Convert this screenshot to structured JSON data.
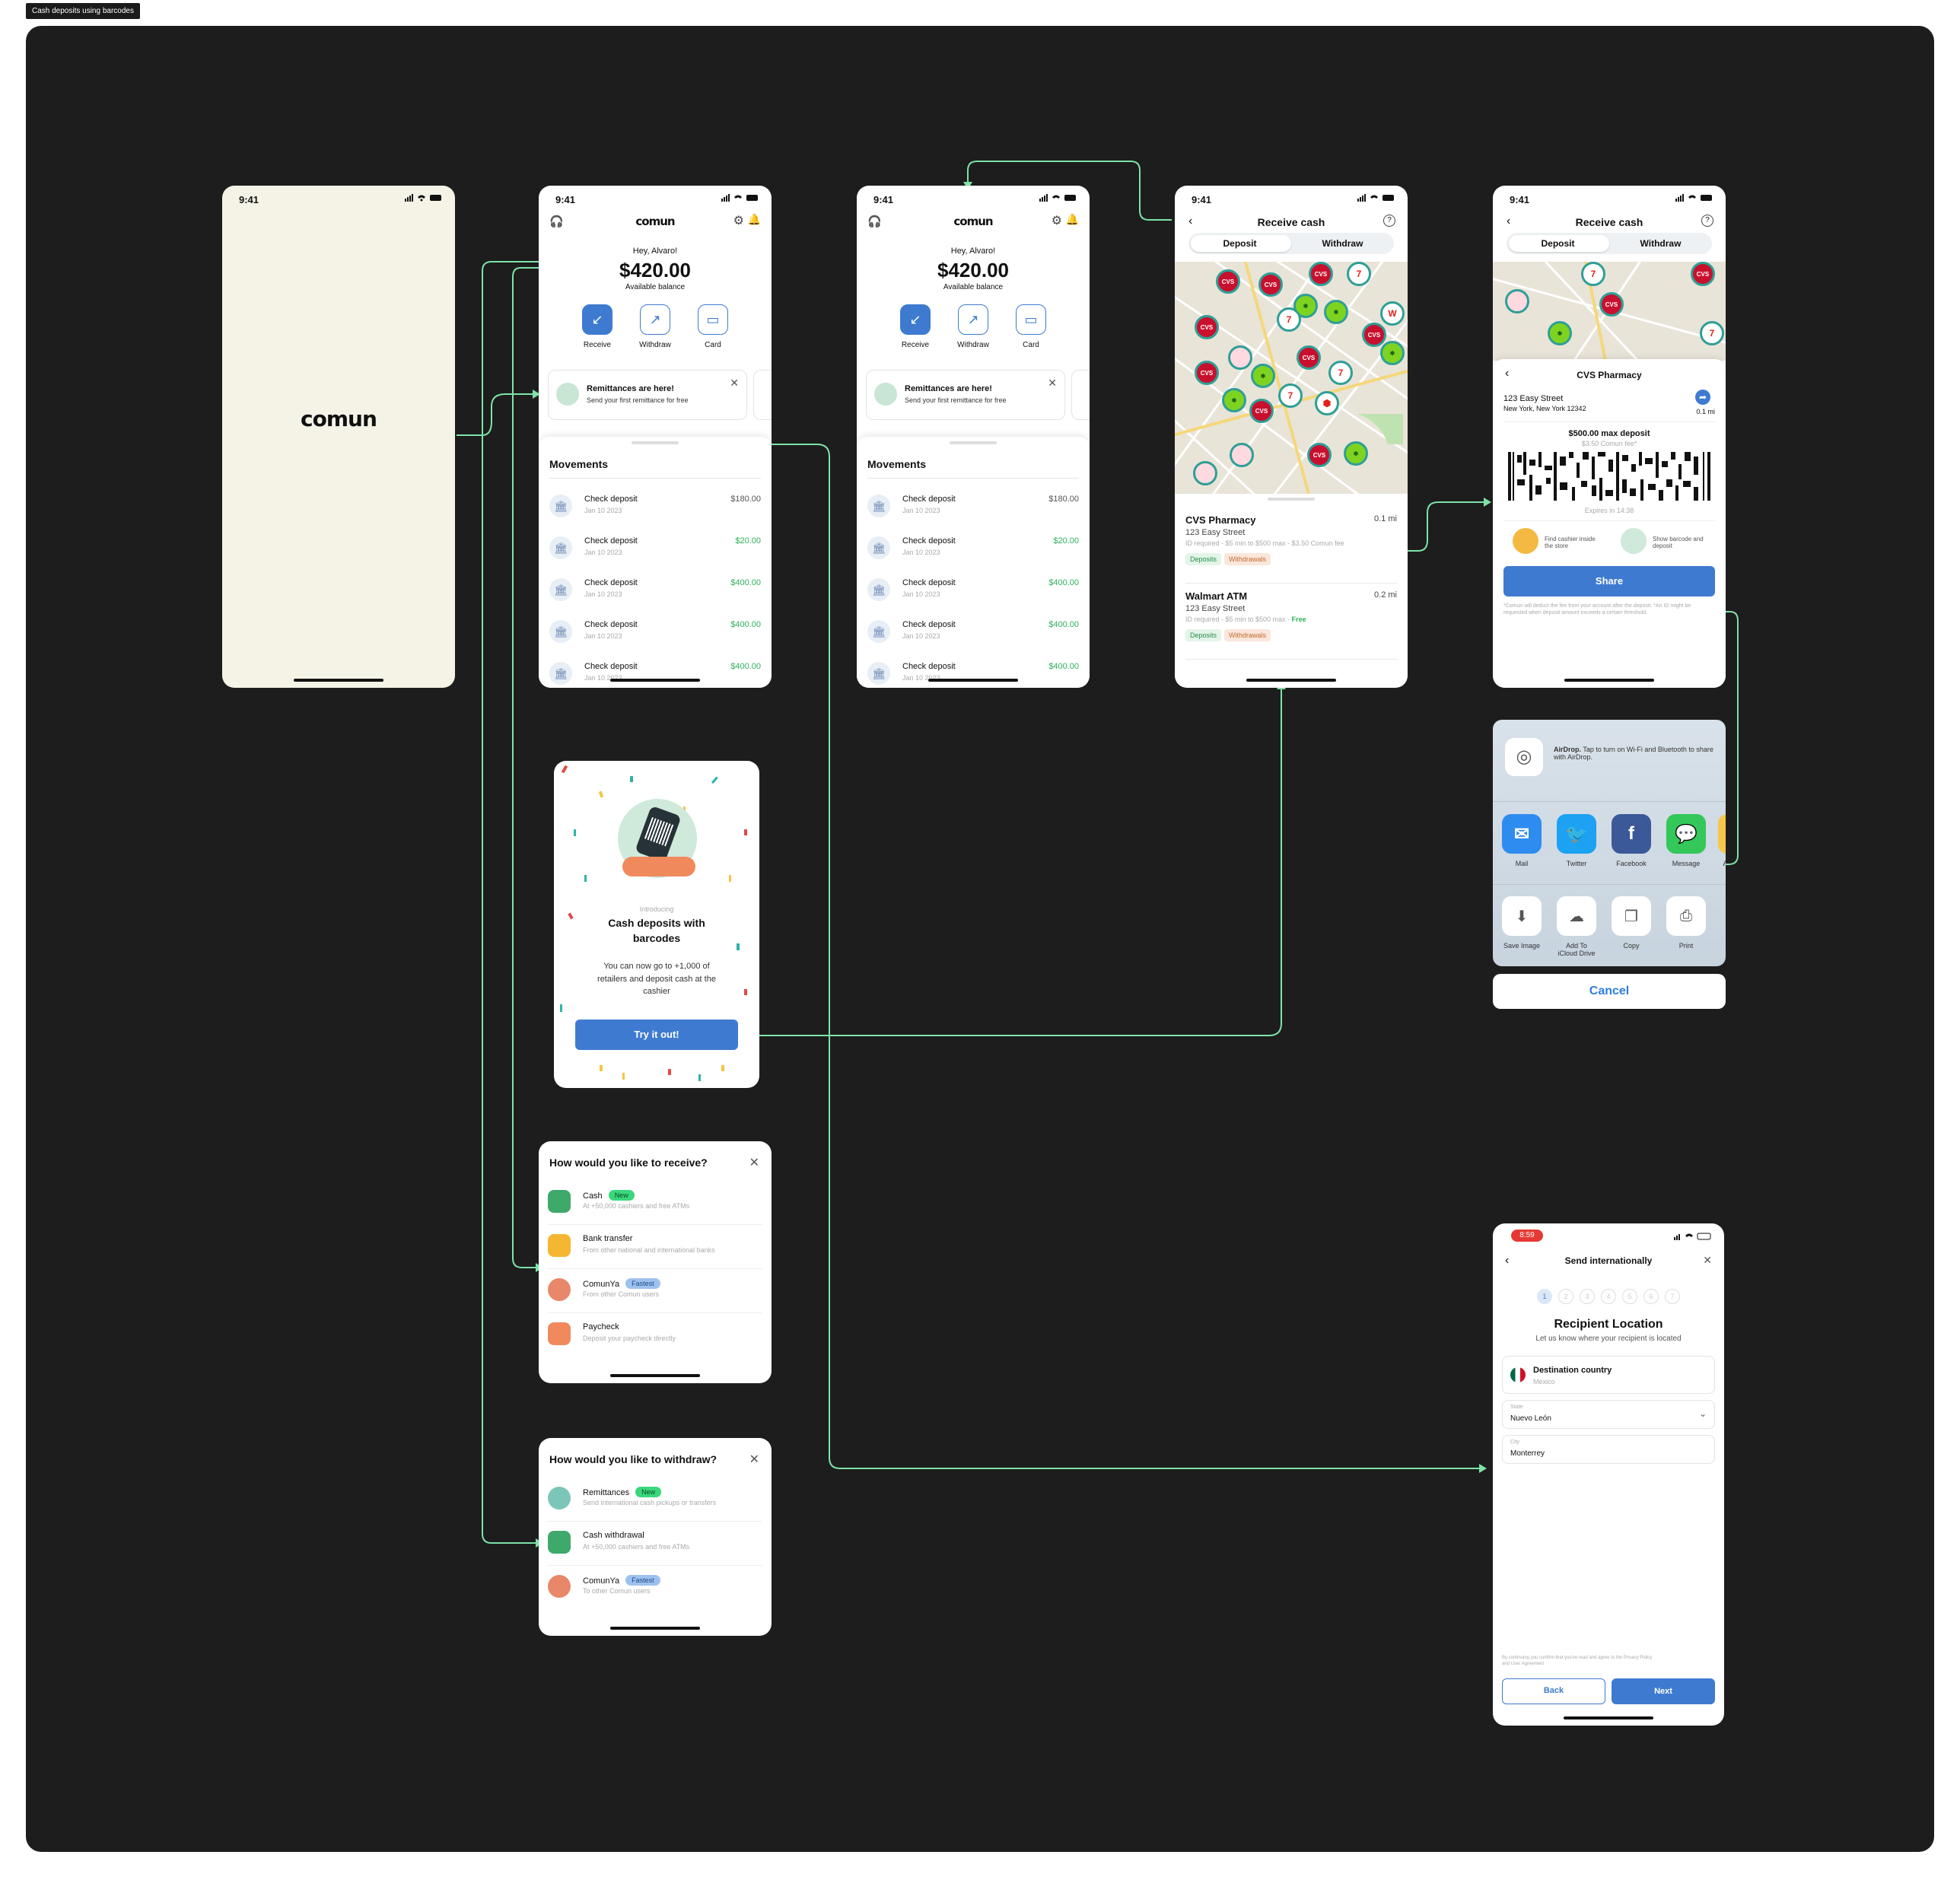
{
  "frame_label": "Cash deposits using barcodes",
  "status_time": "9:41",
  "status_time_alt": "8:59",
  "colors": {
    "canvas": "#1d1d1d",
    "accent": "#3e7bd0",
    "connector": "#7de3a8",
    "splash_bg": "#f4f3e6"
  },
  "brand": "comun",
  "home": {
    "greeting": "Hey, Alvaro!",
    "balance": "$420.00",
    "balance_label": "Available balance",
    "actions": [
      "Receive",
      "Withdraw",
      "Card"
    ],
    "banner_title": "Remittances are here!",
    "banner_sub": "Send your first remittance for free",
    "movements_title": "Movements",
    "movements": [
      {
        "name": "Check deposit",
        "date": "Jan 10 2023",
        "amount": "$180.00",
        "green": false
      },
      {
        "name": "Check deposit",
        "date": "Jan 10 2023",
        "amount": "$20.00",
        "green": true
      },
      {
        "name": "Check deposit",
        "date": "Jan 10 2023",
        "amount": "$400.00",
        "green": true
      },
      {
        "name": "Check deposit",
        "date": "Jan 10 2023",
        "amount": "$400.00",
        "green": true
      },
      {
        "name": "Check deposit",
        "date": "Jan 10 2023",
        "amount": "$400.00",
        "green": true
      }
    ]
  },
  "receive_cash": {
    "title": "Receive cash",
    "tab_deposit": "Deposit",
    "tab_withdraw": "Withdraw",
    "locations": [
      {
        "name": "CVS Pharmacy",
        "distance": "0.1 mi",
        "address": "123 Easy Street",
        "req": "ID required - $5 min to $500 max - $3.50 Comun fee",
        "fee": ""
      },
      {
        "name": "Walmart ATM",
        "distance": "0.2 mi",
        "address": "123 Easy Street",
        "req": "ID required - $5 min to $500 max -",
        "fee": "Free"
      }
    ],
    "chip_deposits": "Deposits",
    "chip_withdrawals": "Withdrawals"
  },
  "barcode": {
    "store": "CVS Pharmacy",
    "address1": "123 Easy Street",
    "address2": "New York, New York 12342",
    "distance": "0.1 mi",
    "max": "$500.00 max deposit",
    "fee": "$3.50 Comun fee*",
    "expires": "Expires in 14:38",
    "step1": "Find cashier inside the store",
    "step2": "Show barcode and deposit",
    "share": "Share",
    "footnote": "*Comun will deduct the fee from your account after the deposit. *An ID might be requested when deposit amount exceeds a certain threshold."
  },
  "share_sheet": {
    "airdrop": "AirDrop.",
    "airdrop_text": "Tap to turn on Wi-Fi and Bluetooth to share with AirDrop.",
    "apps": [
      "Mail",
      "Twitter",
      "Facebook",
      "Message",
      "Ad"
    ],
    "actions": [
      "Save Image",
      "Add To iCloud Drive",
      "Copy",
      "Print"
    ],
    "cancel": "Cancel"
  },
  "intro": {
    "kicker": "Introducing",
    "title": "Cash deposits with barcodes",
    "body": "You can now go to +1,000 of retailers and deposit cash at the cashier",
    "cta": "Try it out!"
  },
  "receive_options": {
    "title": "How would you like to receive?",
    "items": [
      {
        "label": "Cash",
        "badge": "New",
        "sub": "At +50,000 cashiers and free ATMs"
      },
      {
        "label": "Bank transfer",
        "badge": "",
        "sub": "From other national and international banks"
      },
      {
        "label": "ComunYa",
        "badge": "Fastest",
        "sub": "From other Comun users"
      },
      {
        "label": "Paycheck",
        "badge": "",
        "sub": "Deposit your paycheck directly"
      }
    ]
  },
  "withdraw_options": {
    "title": "How would you like to withdraw?",
    "items": [
      {
        "label": "Remittances",
        "badge": "New",
        "sub": "Send international cash pickups or transfers"
      },
      {
        "label": "Cash withdrawal",
        "badge": "",
        "sub": "At +50,000 cashiers and free ATMs"
      },
      {
        "label": "ComunYa",
        "badge": "Fastest",
        "sub": "To other Comun users"
      }
    ]
  },
  "send_intl": {
    "title": "Send internationally",
    "steps": [
      "1",
      "2",
      "3",
      "4",
      "5",
      "6",
      "7"
    ],
    "heading": "Recipient Location",
    "sub": "Let us know where your recipient is located",
    "country_label": "Destination country",
    "country_value": "Mexico",
    "state_label": "State",
    "state_value": "Nuevo León",
    "city_label": "City",
    "city_value": "Monterrey",
    "legal": "By continuing you confirm that you've read and agree to the Privacy Policy and User Agreement",
    "back": "Back",
    "next": "Next"
  }
}
